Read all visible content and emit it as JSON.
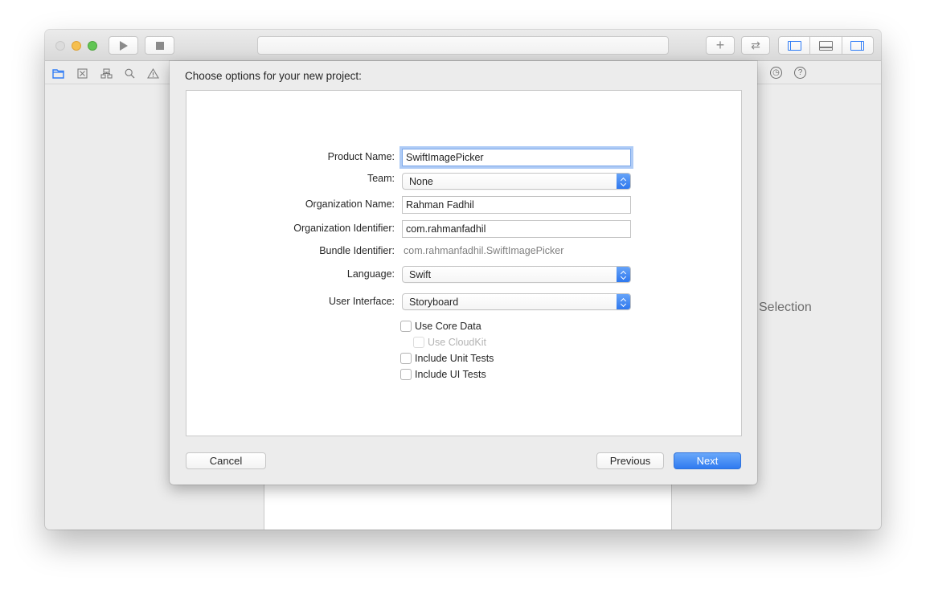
{
  "toolbar": {
    "play_icon": "play-icon",
    "stop_icon": "stop-icon",
    "add_label": "+",
    "swap_label": "⇄"
  },
  "navigator": {
    "icons": [
      "folder-icon",
      "source-control-icon",
      "symbol-hierarchy-icon",
      "search-icon",
      "warning-icon"
    ]
  },
  "inspector": {
    "icons": [
      "history-icon",
      "help-icon"
    ],
    "history_glyph": "◷",
    "help_glyph": "?",
    "no_selection": "Selection"
  },
  "sheet": {
    "title": "Choose options for your new project:",
    "fields": {
      "product_name": {
        "label": "Product Name:",
        "value": "SwiftImagePicker"
      },
      "team": {
        "label": "Team:",
        "value": "None"
      },
      "organization_name": {
        "label": "Organization Name:",
        "value": "Rahman Fadhil"
      },
      "organization_identifier": {
        "label": "Organization Identifier:",
        "value": "com.rahmanfadhil"
      },
      "bundle_identifier": {
        "label": "Bundle Identifier:",
        "value": "com.rahmanfadhil.SwiftImagePicker"
      },
      "language": {
        "label": "Language:",
        "value": "Swift"
      },
      "user_interface": {
        "label": "User Interface:",
        "value": "Storyboard"
      }
    },
    "checkboxes": {
      "use_core_data": {
        "label": "Use Core Data",
        "checked": false
      },
      "use_cloudkit": {
        "label": "Use CloudKit",
        "checked": false,
        "enabled": false
      },
      "include_unit_tests": {
        "label": "Include Unit Tests",
        "checked": false
      },
      "include_ui_tests": {
        "label": "Include UI Tests",
        "checked": false
      }
    },
    "buttons": {
      "cancel": "Cancel",
      "previous": "Previous",
      "next": "Next"
    }
  },
  "colors": {
    "accent": "#2f7af0",
    "focus_ring": "#7aa7ea",
    "close_light": "#dcdcdc",
    "minimize_light": "#f5bf4f",
    "zoom_light": "#61c554"
  }
}
